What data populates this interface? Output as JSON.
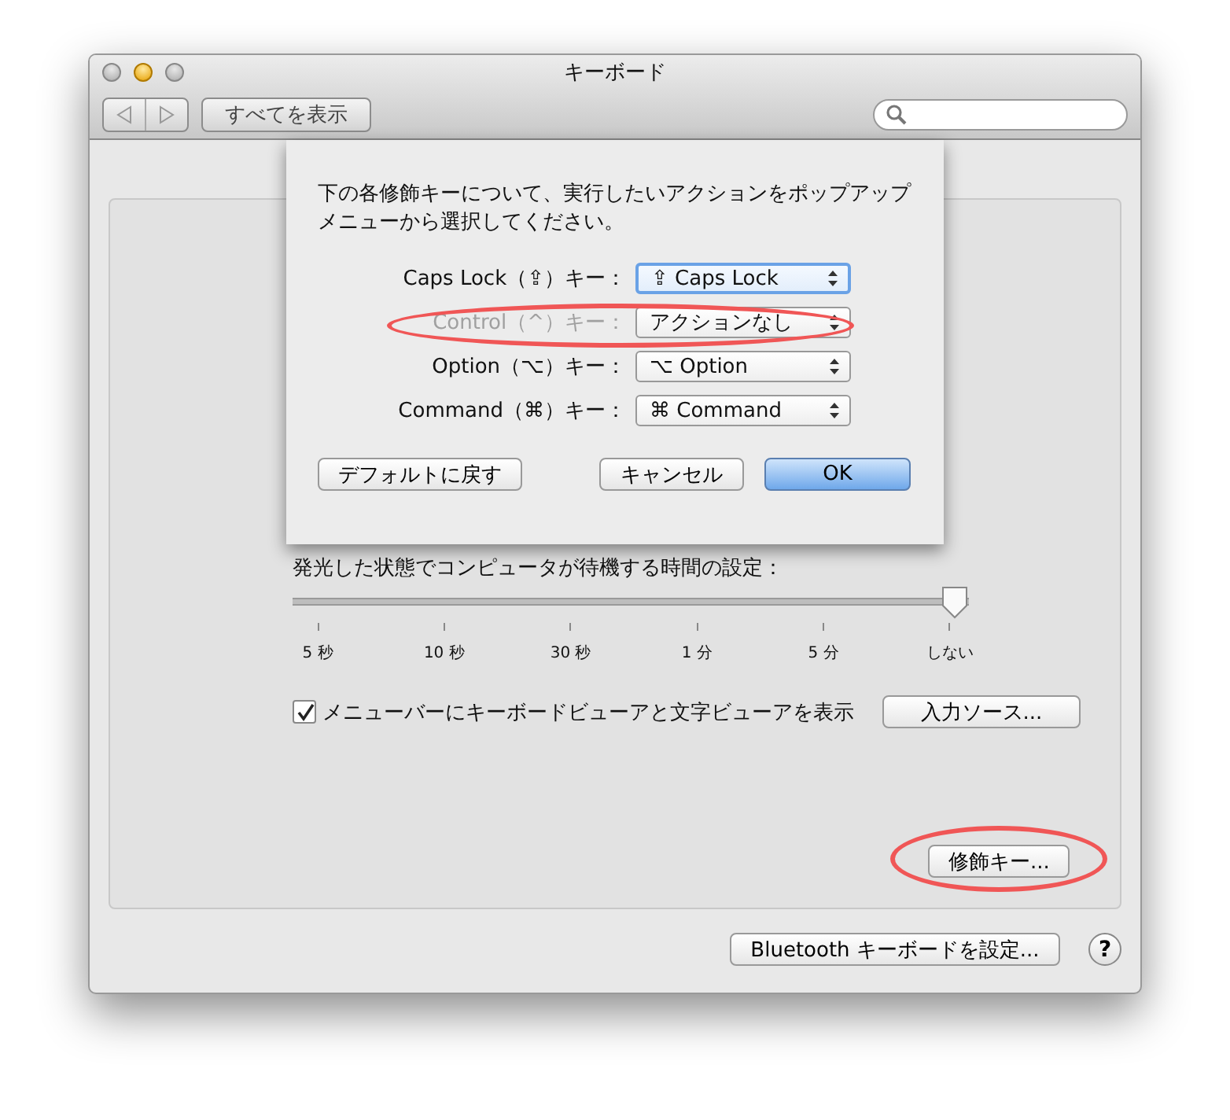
{
  "window": {
    "title": "キーボード"
  },
  "toolbar": {
    "show_all": "すべてを表示"
  },
  "sheet": {
    "message": "下の各修飾キーについて、実行したいアクションをポップアップメニューから選択してください。",
    "rows": [
      {
        "label": "Caps Lock（⇪）キー：",
        "value": "⇪ Caps Lock",
        "disabled": false,
        "focused": true
      },
      {
        "label": "Control（^）キー：",
        "value": "アクションなし",
        "disabled": true,
        "focused": false
      },
      {
        "label": "Option（⌥）キー：",
        "value": "⌥ Option",
        "disabled": false,
        "focused": false
      },
      {
        "label": "Command（⌘）キー：",
        "value": "⌘ Command",
        "disabled": false,
        "focused": false
      }
    ],
    "buttons": [
      {
        "label": "デフォルトに戻す",
        "kind": "restore"
      },
      {
        "label": "キャンセル",
        "kind": "cancel"
      },
      {
        "label": "OK",
        "kind": "default"
      }
    ]
  },
  "panel": {
    "slider": {
      "label": "発光した状態でコンピュータが待機する時間の設定：",
      "level": 1,
      "ticks": [
        "5 秒",
        "10 秒",
        "30 秒",
        "1 分",
        "5 分",
        "しない"
      ]
    },
    "checkbox": {
      "label": "メニューバーにキーボードビューアと文字ビューアを表示",
      "checked": true
    },
    "input_sources_button": "入力ソース...",
    "modifier_keys_button": "修飾キー..."
  },
  "bluetooth_button": "Bluetooth キーボードを設定...",
  "help": "?"
}
